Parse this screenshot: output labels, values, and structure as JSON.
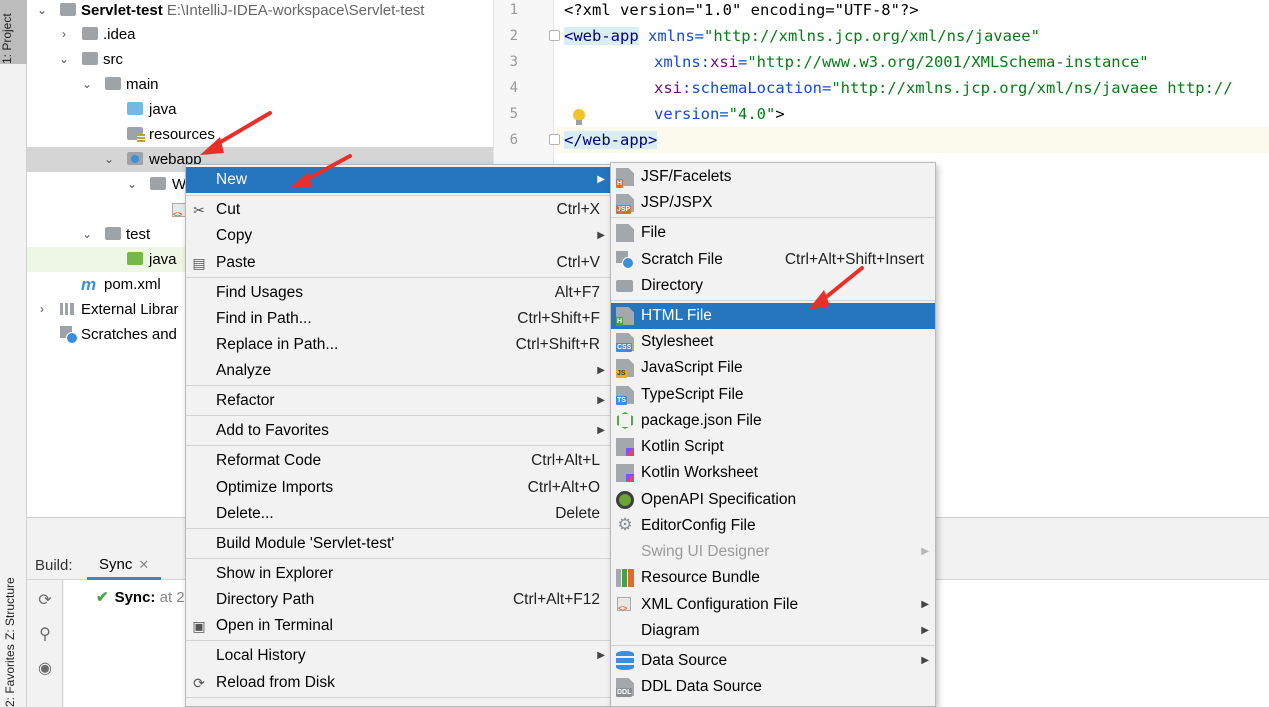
{
  "sidebar": {
    "project_tab": "1: Project",
    "structure_tab": "Z: Structure",
    "favorites_tab": "2: Favorites"
  },
  "project_tree": {
    "root": {
      "name": "Servlet-test",
      "path": "E:\\IntelliJ-IDEA-workspace\\Servlet-test"
    },
    "items": [
      {
        "name": ".idea"
      },
      {
        "name": "src"
      },
      {
        "name": "main"
      },
      {
        "name": "java"
      },
      {
        "name": "resources"
      },
      {
        "name": "webapp"
      },
      {
        "name": "W"
      },
      {
        "name": "test"
      },
      {
        "name": "java"
      },
      {
        "name": "pom.xml"
      },
      {
        "name": "External Librar"
      },
      {
        "name": "Scratches and"
      }
    ]
  },
  "editor": {
    "line_numbers": [
      "1",
      "2",
      "3",
      "4",
      "5",
      "6"
    ],
    "lines": [
      {
        "decl": "<?xml version=\"1.0\" encoding=\"UTF-8\"?>"
      },
      {
        "tag": "<web-app",
        "attr": " xmlns=",
        "val": "\"http://xmlns.jcp.org/xml/ns/javaee\""
      },
      {
        "attr1": "xmlns:",
        "ns": "xsi",
        "attr2": "=",
        "val": "\"http://www.w3.org/2001/XMLSchema-instance\""
      },
      {
        "ns": "xsi",
        "attr": ":schemaLocation=",
        "val": "\"http://xmlns.jcp.org/xml/ns/javaee http://"
      },
      {
        "attr": "version=",
        "val": "\"4.0\"",
        "end": ">"
      },
      {
        "tag": "</web-app>"
      }
    ]
  },
  "build_panel": {
    "label": "Build:",
    "tab": "Sync",
    "close": "✕",
    "sync_status": "Sync:",
    "sync_when": "at 2"
  },
  "context_menu": {
    "items": [
      {
        "label": "New",
        "shortcut": "",
        "submenu": true
      },
      {
        "label": "Cut",
        "shortcut": "Ctrl+X"
      },
      {
        "label": "Copy",
        "shortcut": "",
        "submenu": true
      },
      {
        "label": "Paste",
        "shortcut": "Ctrl+V"
      },
      {
        "label": "Find Usages",
        "shortcut": "Alt+F7"
      },
      {
        "label": "Find in Path...",
        "shortcut": "Ctrl+Shift+F"
      },
      {
        "label": "Replace in Path...",
        "shortcut": "Ctrl+Shift+R"
      },
      {
        "label": "Analyze",
        "shortcut": "",
        "submenu": true
      },
      {
        "label": "Refactor",
        "shortcut": "",
        "submenu": true
      },
      {
        "label": "Add to Favorites",
        "shortcut": "",
        "submenu": true
      },
      {
        "label": "Reformat Code",
        "shortcut": "Ctrl+Alt+L"
      },
      {
        "label": "Optimize Imports",
        "shortcut": "Ctrl+Alt+O"
      },
      {
        "label": "Delete...",
        "shortcut": "Delete"
      },
      {
        "label": "Build Module 'Servlet-test'",
        "shortcut": ""
      },
      {
        "label": "Show in Explorer",
        "shortcut": ""
      },
      {
        "label": "Directory Path",
        "shortcut": "Ctrl+Alt+F12"
      },
      {
        "label": "Open in Terminal",
        "shortcut": ""
      },
      {
        "label": "Local History",
        "shortcut": "",
        "submenu": true
      },
      {
        "label": "Reload from Disk",
        "shortcut": ""
      }
    ]
  },
  "new_submenu": {
    "items": [
      {
        "label": "JSF/Facelets",
        "badge": "H"
      },
      {
        "label": "JSP/JSPX",
        "badge": "JSP"
      },
      {
        "label": "File"
      },
      {
        "label": "Scratch File",
        "shortcut": "Ctrl+Alt+Shift+Insert"
      },
      {
        "label": "Directory"
      },
      {
        "label": "HTML File",
        "badge": "H"
      },
      {
        "label": "Stylesheet",
        "badge": "CSS"
      },
      {
        "label": "JavaScript File",
        "badge": "JS"
      },
      {
        "label": "TypeScript File",
        "badge": "TS"
      },
      {
        "label": "package.json File"
      },
      {
        "label": "Kotlin Script"
      },
      {
        "label": "Kotlin Worksheet"
      },
      {
        "label": "OpenAPI Specification"
      },
      {
        "label": "EditorConfig File"
      },
      {
        "label": "Swing UI Designer",
        "submenu": true
      },
      {
        "label": "Resource Bundle"
      },
      {
        "label": "XML Configuration File",
        "submenu": true
      },
      {
        "label": "Diagram",
        "submenu": true
      },
      {
        "label": "Data Source",
        "submenu": true
      },
      {
        "label": "DDL Data Source"
      }
    ]
  },
  "colors": {
    "menu_highlight": "#2675bf",
    "arrow_red": "#e8302b",
    "tag_bg": "#d8eef3"
  }
}
